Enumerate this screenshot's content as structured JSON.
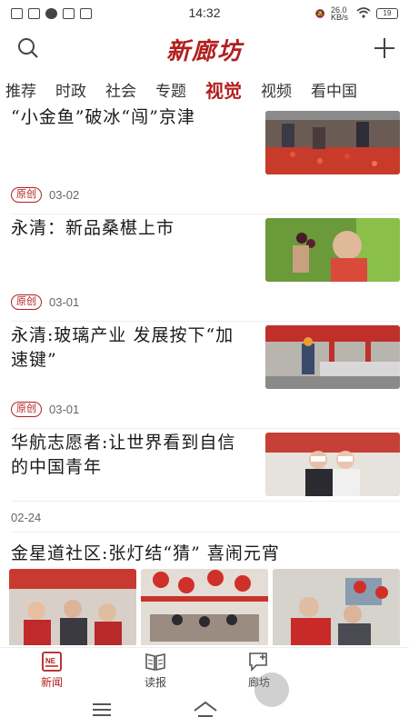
{
  "status_bar": {
    "time": "14:32",
    "net_speed": "26.0 KB/s",
    "battery": "19"
  },
  "header": {
    "logo": "新廊坊"
  },
  "tabs": [
    {
      "label": "推荐"
    },
    {
      "label": "时政"
    },
    {
      "label": "社会"
    },
    {
      "label": "专题"
    },
    {
      "label": "视觉"
    },
    {
      "label": "视频"
    },
    {
      "label": "看中国"
    }
  ],
  "feed": [
    {
      "title": "“小金鱼”破冰“闯”京津",
      "badge": "原创",
      "date": "03-02"
    },
    {
      "title": "永清：新品桑椹上市",
      "badge": "原创",
      "date": "03-01"
    },
    {
      "title": "永清:玻璃产业  发展按下“加速键”",
      "badge": "原创",
      "date": "03-01"
    },
    {
      "title": "华航志愿者:让世界看到自信的中国青年",
      "date": "02-24"
    }
  ],
  "gallery": {
    "title": "金星道社区:张灯结“猜”  喜闹元宵"
  },
  "bottom_nav": [
    {
      "label": "新闻"
    },
    {
      "label": "读报"
    },
    {
      "label": "廊坊"
    }
  ],
  "colors": {
    "accent": "#b21f1f"
  }
}
